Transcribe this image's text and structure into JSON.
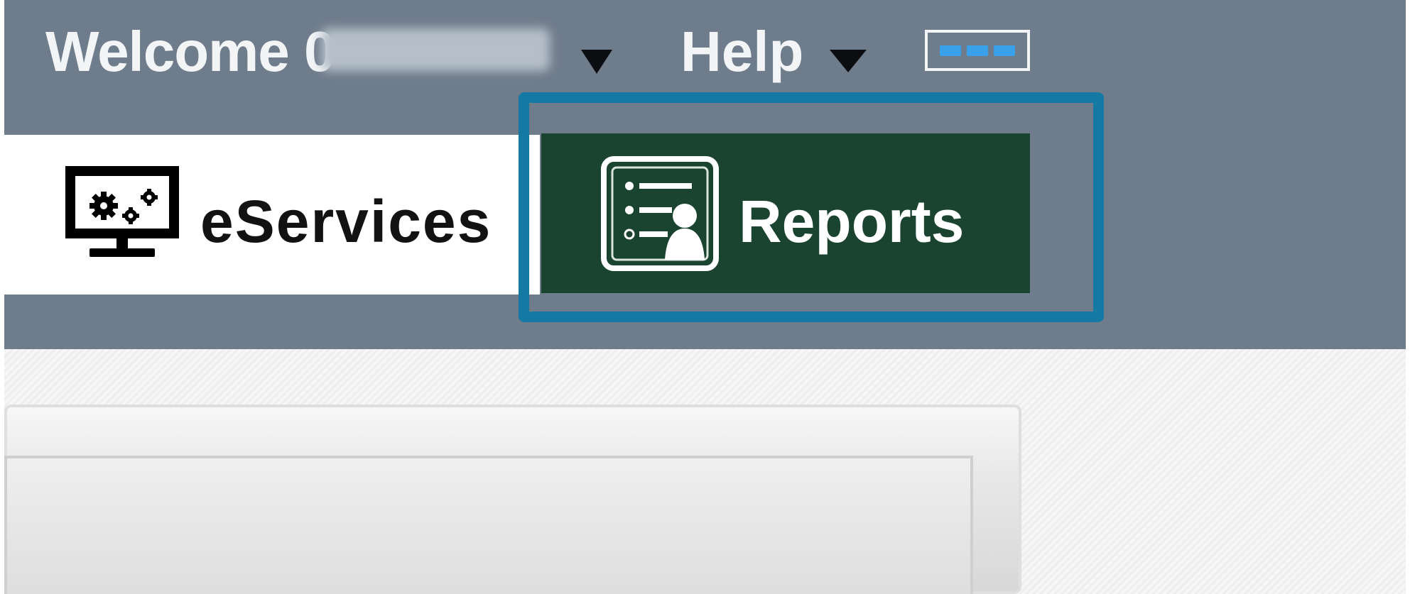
{
  "header": {
    "welcome_label": "Welcome 0",
    "help_label": "Help"
  },
  "tabs": {
    "eservices": {
      "label": "eServices",
      "icon": "monitor-gears-icon"
    },
    "reports": {
      "label": "Reports",
      "icon": "report-profile-icon",
      "selected": true
    }
  },
  "icons": {
    "keyboard": "keyboard-icon"
  },
  "colors": {
    "header_bg": "#6f7c8b",
    "reports_tab_bg": "#1a4330",
    "highlight": "#157aa3",
    "keyboard_keys": "#3aa0ea"
  }
}
